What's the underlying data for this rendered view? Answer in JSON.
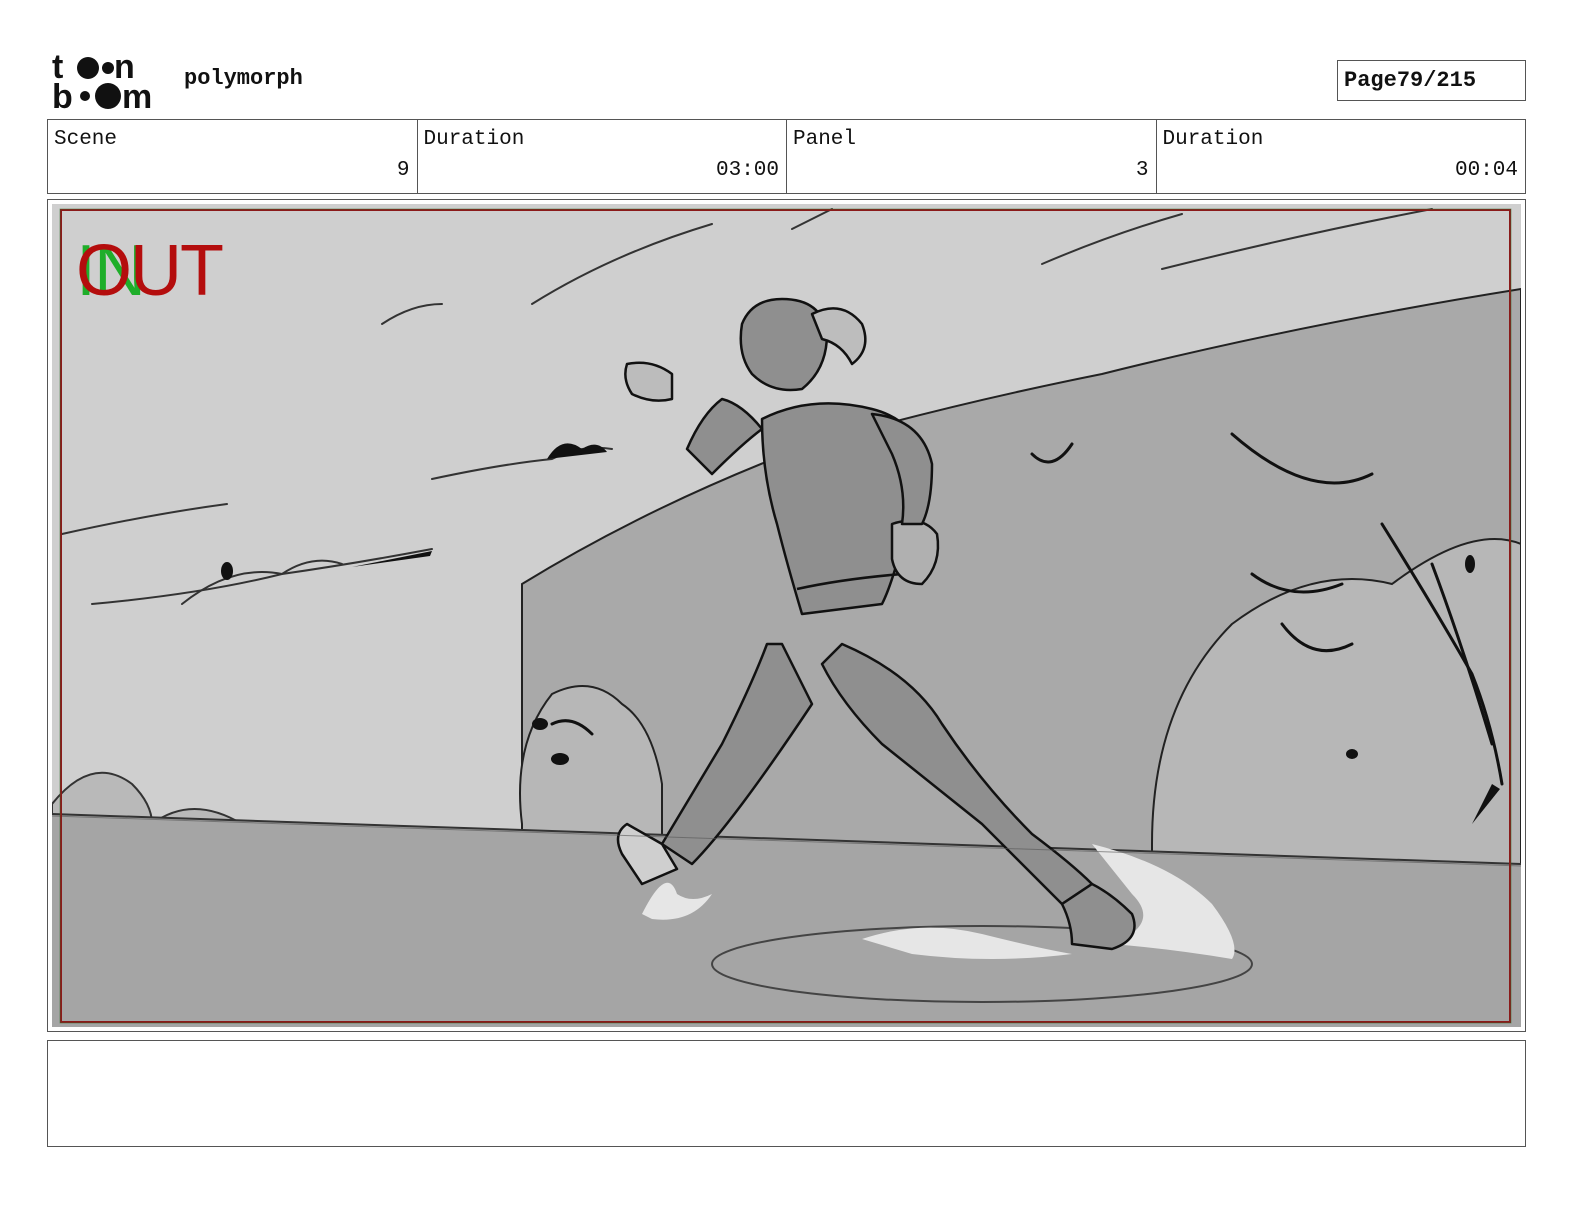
{
  "header": {
    "logo_text": "toon boom",
    "project_name": "polymorph",
    "page_label": "Page",
    "page_value": "79/215"
  },
  "info": {
    "scene_label": "Scene",
    "scene_value": "9",
    "scene_duration_label": "Duration",
    "scene_duration_value": "03:00",
    "panel_label": "Panel",
    "panel_value": "3",
    "panel_duration_label": "Duration",
    "panel_duration_value": "00:04"
  },
  "panel": {
    "in_marker": "IN",
    "out_marker": "OUT",
    "colors": {
      "in": "#1fae2a",
      "out": "#b40d0d",
      "frame": "#8b1a1a"
    }
  },
  "notes": {
    "text": ""
  }
}
